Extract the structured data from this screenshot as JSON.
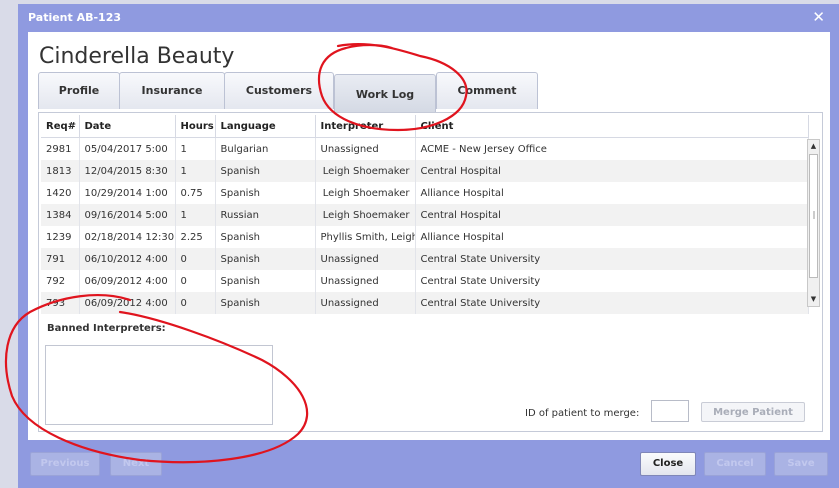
{
  "window": {
    "title": "Patient AB-123",
    "close_glyph": "✕"
  },
  "patient": {
    "name": "Cinderella Beauty"
  },
  "tabs": [
    {
      "label": "Profile"
    },
    {
      "label": "Insurance"
    },
    {
      "label": "Customers"
    },
    {
      "label": "Work Log",
      "active": true
    },
    {
      "label": "Comment"
    }
  ],
  "worklog": {
    "columns": [
      "Req#",
      "Date",
      "Hours",
      "Language",
      "Interpreter",
      "Client"
    ],
    "rows": [
      [
        "2981",
        "05/04/2017 5:00",
        "1",
        "Bulgarian",
        "Unassigned",
        "ACME - New Jersey Office"
      ],
      [
        "1813",
        "12/04/2015 8:30",
        "1",
        "Spanish",
        "Leigh Shoemaker",
        "Central Hospital"
      ],
      [
        "1420",
        "10/29/2014 1:00",
        "0.75",
        "Spanish",
        "Leigh Shoemaker",
        "Alliance Hospital"
      ],
      [
        "1384",
        "09/16/2014 5:00",
        "1",
        "Russian",
        "Leigh Shoemaker",
        "Central Hospital"
      ],
      [
        "1239",
        "02/18/2014 12:30",
        "2.25",
        "Spanish",
        "Phyllis Smith, Leigh",
        "Alliance Hospital"
      ],
      [
        "791",
        "06/10/2012 4:00",
        "0",
        "Spanish",
        "Unassigned",
        "Central State University"
      ],
      [
        "792",
        "06/09/2012 4:00",
        "0",
        "Spanish",
        "Unassigned",
        "Central State University"
      ],
      [
        "793",
        "06/09/2012 4:00",
        "0",
        "Spanish",
        "Unassigned",
        "Central State University"
      ]
    ],
    "scroll_up_glyph": "▲",
    "scroll_down_glyph": "▼"
  },
  "banned": {
    "label": "Banned Interpreters:"
  },
  "merge": {
    "label": "ID of patient to merge:",
    "value": "",
    "button": "Merge Patient"
  },
  "footer": {
    "previous": "Previous",
    "next": "Next",
    "close": "Close",
    "cancel": "Cancel",
    "save": "Save"
  },
  "colors": {
    "frame": "#8f9ae0",
    "annotation": "#e0141e"
  }
}
